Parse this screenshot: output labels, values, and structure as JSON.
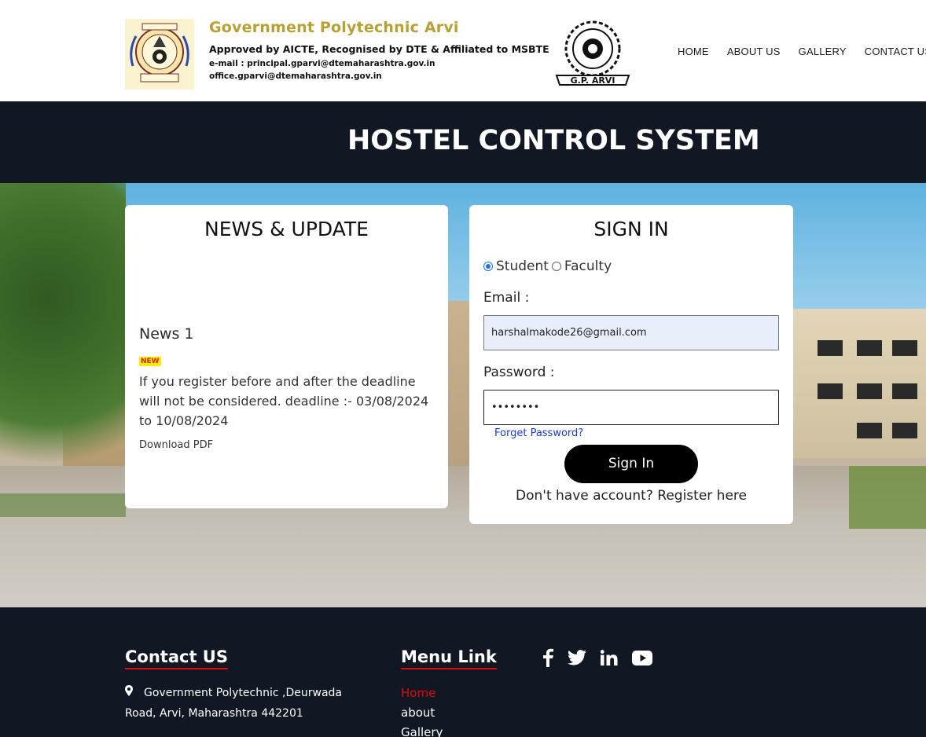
{
  "header": {
    "college_name": "Government Polytechnic Arvi",
    "approval": "Approved by AICTE, Recognised by DTE & Affiliated to MSBTE",
    "email_line1": "e-mail : principal.gparvi@dtemaharashtra.gov.in",
    "email_line2": "office.gparvi@dtemaharashtra.gov.in",
    "right_logo_text": "G.P. ARVI",
    "nav": [
      "HOME",
      "ABOUT US",
      "GALLERY",
      "CONTACT US"
    ]
  },
  "banner": {
    "title": "HOSTEL CONTROL SYSTEM"
  },
  "news": {
    "title": "NEWS & UPDATE",
    "item_title": "News 1",
    "badge": "NEW",
    "text": "If you register before and after the deadline will not be considered. deadline :- 03/08/2024 to 10/08/2024",
    "download": "Download PDF"
  },
  "signin": {
    "title": "SIGN IN",
    "role_student": "Student",
    "role_faculty": "Faculty",
    "selected_role": "Student",
    "email_label": "Email :",
    "email_value": "harshalmakode26@gmail.com",
    "password_label": "Password :",
    "password_value": "••••••••",
    "forget": "Forget Password?",
    "button": "Sign In",
    "register": "Don't have account? Register here"
  },
  "footer": {
    "contact_heading": "Contact US",
    "address": "Government Polytechnic ,Deurwada Road, Arvi, Maharashtra 442201",
    "menu_heading": "Menu Link",
    "menu": [
      "Home",
      "about",
      "Gallery"
    ],
    "social": [
      "facebook-icon",
      "twitter-icon",
      "linkedin-icon",
      "youtube-icon"
    ]
  },
  "colors": {
    "brand_gold": "#b9a032",
    "dark_bg": "#111723",
    "accent_red": "#e10b0b",
    "link_blue": "#1a3ad6"
  }
}
